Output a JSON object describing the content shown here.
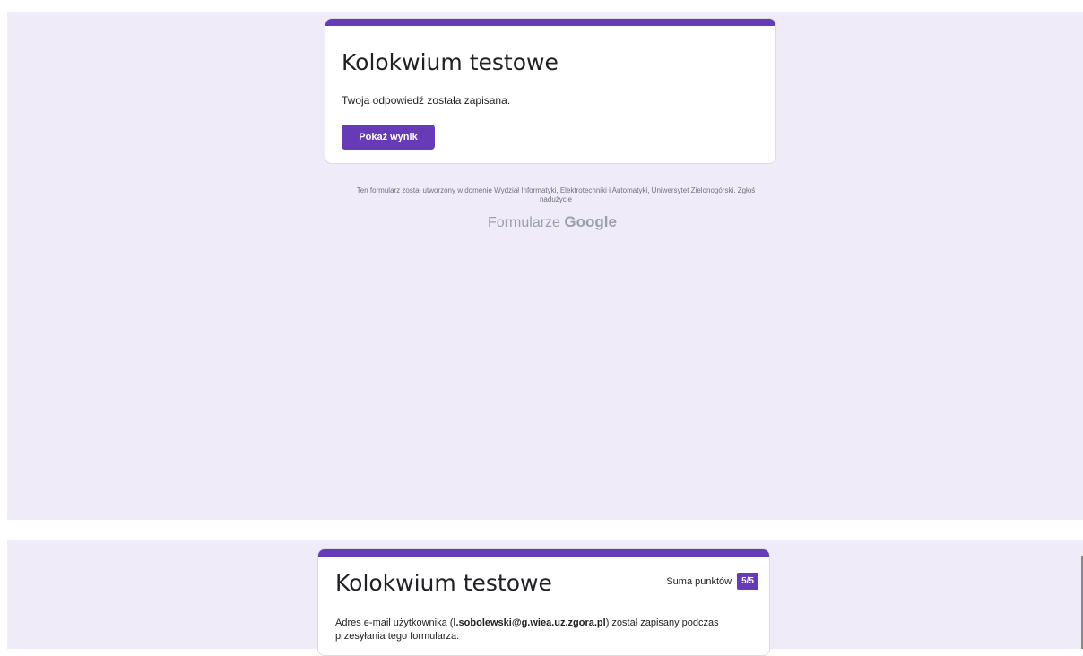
{
  "top_view": {
    "form_title": "Kolokwium testowe",
    "saved_message": "Twoja odpowiedź została zapisana.",
    "show_score_button": "Pokaż wynik",
    "footer_text": "Ten formularz został utworzony w domenie Wydział Informatyki, Elektrotechniki i Automatyki, Uniwersytet Zielonogórski.",
    "report_link": "Zgłoś nadużycie",
    "brand_prefix": "Formularze",
    "brand_name": "Google"
  },
  "bottom_view": {
    "form_title": "Kolokwium testowe",
    "score_label": "Suma punktów",
    "score_value": "5/5",
    "email_prefix": "Adres e-mail użytkownika (",
    "email": "l.sobolewski@g.wiea.uz.zgora.pl",
    "email_suffix": ") został zapisany podczas przesyłania tego formularza."
  },
  "colors": {
    "accent": "#673ab7",
    "page_background": "#efebf8"
  }
}
